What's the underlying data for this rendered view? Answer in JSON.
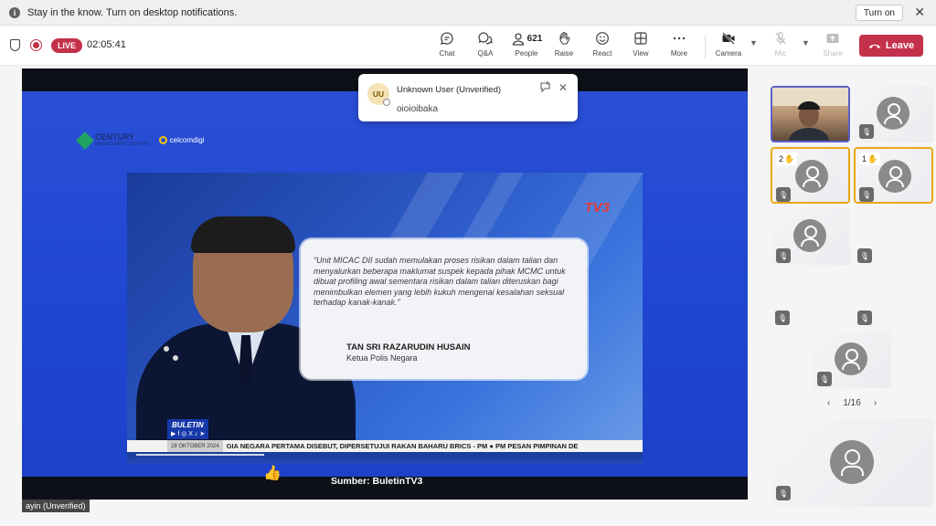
{
  "notification": {
    "message": "Stay in the know. Turn on desktop notifications.",
    "turn_on_label": "Turn on",
    "close_glyph": "✕"
  },
  "toolbar": {
    "live_label": "LIVE",
    "timer": "02:05:41",
    "chat_label": "Chat",
    "qa_label": "Q&A",
    "people_label": "People",
    "people_count": "621",
    "raise_label": "Raise",
    "react_label": "React",
    "view_label": "View",
    "more_label": "More",
    "camera_label": "Camera",
    "mic_label": "Mic",
    "share_label": "Share",
    "leave_label": "Leave",
    "leave_color": "#c4314b"
  },
  "chat_popup": {
    "avatar_initials": "UU",
    "user": "Unknown User (Unverified)",
    "message": "oioioibaka"
  },
  "slide": {
    "logo1_text": "CENTURY",
    "logo1_sub": "MANAGEMENT SDN BHD",
    "logo2_text": "celcomdigi",
    "video": {
      "channel": "TV3",
      "quote": "“Unit MICAC DII sudah memulakan proses risikan dalam talian dan menyalurkan beberapa maklumat suspek kepada pihak MCMC untuk dibuat profiling awal sementara risikan dalam talian diteruskan bagi menimbulkan elemen yang lebih kukuh mengenai kesalahan seksual terhadap kanak-kanak.”",
      "speaker_name": "TAN SRI RAZARUDIN HUSAIN",
      "speaker_role": "Ketua Polis Negara",
      "buletin": "BULETIN",
      "date": "28 OKTOBER 2024",
      "ticker": "GIA NEGARA PERTAMA DISEBUT, DIPERSETUJUI RAKAN BAHARU BRICS - PM   ●   PM PESAN PIMPINAN DE"
    },
    "source": "Sumber: BuletinTV3"
  },
  "stage_label": "ayin (Unverified)",
  "participants": {
    "tile_hand_2": "2",
    "tile_hand_1": "1",
    "pager": "1/16",
    "prev": "‹",
    "next": "›"
  }
}
